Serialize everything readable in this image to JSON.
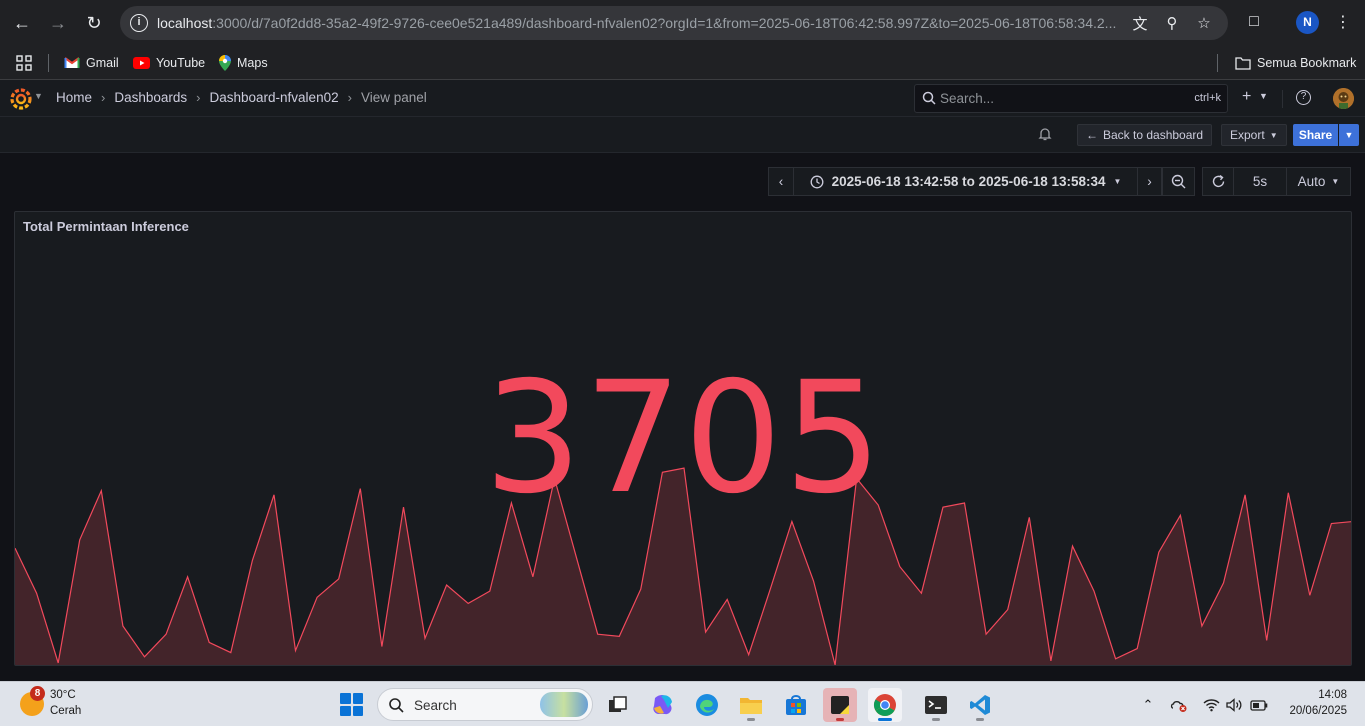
{
  "browser": {
    "url_host": "localhost",
    "url_rest": ":3000/d/7a0f2dd8-35a2-49f2-9726-cee0e521a489/dashboard-nfvalen02?orgId=1&from=2025-06-18T06:42:58.997Z&to=2025-06-18T06:58:34.2...",
    "profile_initial": "N",
    "bookmarks": [
      {
        "label": "Gmail",
        "icon": "gmail-icon"
      },
      {
        "label": "YouTube",
        "icon": "youtube-icon"
      },
      {
        "label": "Maps",
        "icon": "maps-icon"
      }
    ],
    "all_bookmarks_label": "Semua Bookmark"
  },
  "grafana": {
    "breadcrumbs": [
      "Home",
      "Dashboards",
      "Dashboard-nfvalen02",
      "View panel"
    ],
    "search_placeholder": "Search...",
    "search_shortcut": "ctrl+k",
    "toolbar": {
      "back_label": "Back to dashboard",
      "export_label": "Export",
      "share_label": "Share"
    },
    "time_range": "2025-06-18 13:42:58 to 2025-06-18 13:58:34",
    "refresh_interval": "5s",
    "refresh_mode": "Auto",
    "panel": {
      "title": "Total Permintaan Inference",
      "value": "3705",
      "color": "#f2495c"
    }
  },
  "chart_data": {
    "type": "area",
    "title": "Total Permintaan Inference",
    "series": [
      {
        "values": [
          58,
          36,
          2,
          62,
          86,
          20,
          5,
          16,
          44,
          12,
          7,
          52,
          84,
          8,
          34,
          43,
          87,
          10,
          78,
          14,
          40,
          31,
          37,
          80,
          44,
          92,
          54,
          16,
          15,
          38,
          95,
          97,
          17,
          33,
          6,
          38,
          71,
          42,
          1,
          92,
          79,
          49,
          36,
          78,
          80,
          16,
          28,
          73,
          3,
          59,
          37,
          4,
          9,
          56,
          74,
          20,
          41,
          84,
          13,
          85,
          35,
          70,
          71
        ]
      }
    ],
    "ylim": [
      0,
      100
    ]
  },
  "taskbar": {
    "weather_badge": "8",
    "temperature": "30°C",
    "condition": "Cerah",
    "search_label": "Search",
    "time": "14:08",
    "date": "20/06/2025"
  }
}
